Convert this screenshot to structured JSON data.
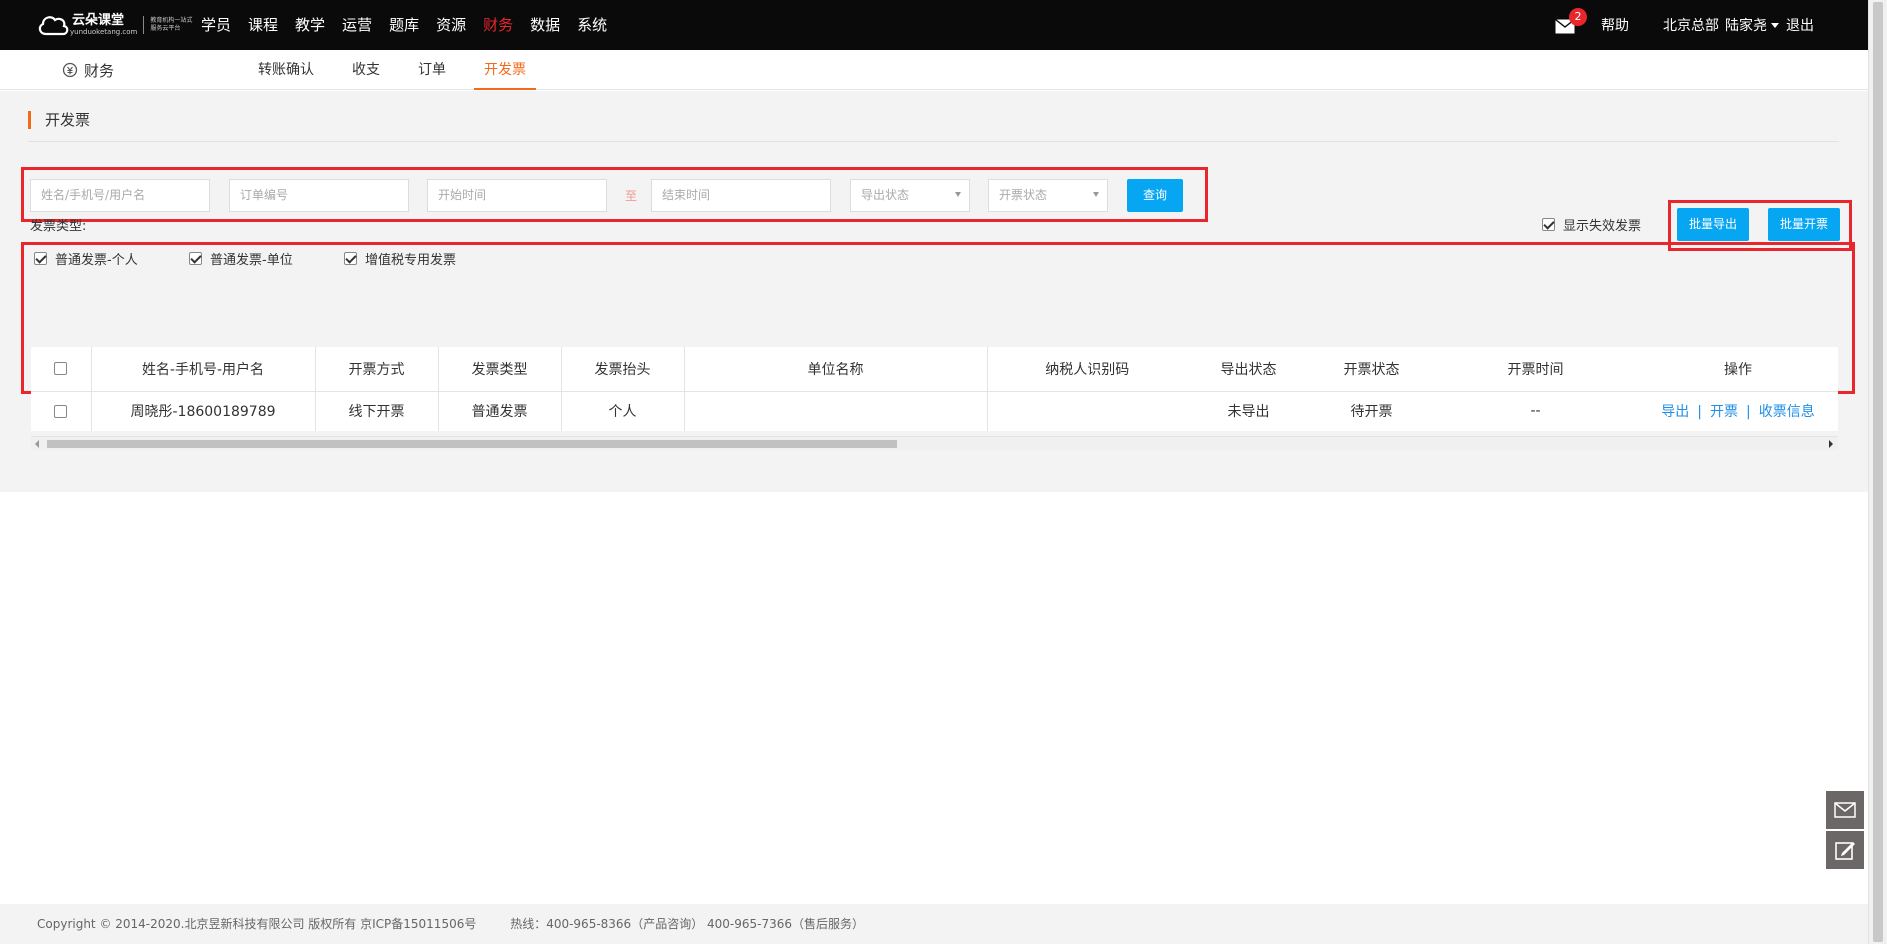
{
  "header": {
    "logo": {
      "name": "云朵课堂",
      "domain": "yunduoketang.com",
      "slogan": "教育机构一站式服务云平台"
    },
    "nav": [
      "学员",
      "课程",
      "教学",
      "运营",
      "题库",
      "资源",
      "财务",
      "数据",
      "系统"
    ],
    "active_nav": "财务",
    "mail_count": "2",
    "help": "帮助",
    "org": "北京总部",
    "user": "陆家尧",
    "logout": "退出"
  },
  "subnav": {
    "module": "财务",
    "tabs": [
      "转账确认",
      "收支",
      "订单",
      "开发票"
    ],
    "active_tab": "开发票"
  },
  "page": {
    "title": "开发票"
  },
  "filters": {
    "name_placeholder": "姓名/手机号/用户名",
    "order_placeholder": "订单编号",
    "start_placeholder": "开始时间",
    "to_label": "至",
    "end_placeholder": "结束时间",
    "export_status": "导出状态",
    "invoice_status": "开票状态",
    "query_button": "查询"
  },
  "invoice_type": {
    "label": "发票类型:",
    "options": [
      {
        "label": "普通发票-个人",
        "checked": true
      },
      {
        "label": "普通发票-单位",
        "checked": true
      },
      {
        "label": "增值税专用发票",
        "checked": true
      }
    ]
  },
  "actions": {
    "show_invalid": "显示失效发票",
    "show_invalid_checked": true,
    "batch_export": "批量导出",
    "batch_invoice": "批量开票"
  },
  "table": {
    "columns": [
      "姓名-手机号-用户名",
      "开票方式",
      "发票类型",
      "发票抬头",
      "单位名称",
      "纳税人识别码",
      "导出状态",
      "开票状态",
      "开票时间",
      "操作"
    ],
    "rows": [
      {
        "name": "周晓彤-18600189789",
        "method": "线下开票",
        "type": "普通发票",
        "title": "个人",
        "company": "",
        "tax_id": "",
        "export_status": "未导出",
        "invoice_status": "待开票",
        "invoice_time": "--",
        "ops": [
          "导出",
          "开票",
          "收票信息"
        ]
      }
    ]
  },
  "footer": {
    "copyright": "Copyright © 2014-2020.北京昱新科技有限公司 版权所有 京ICP备15011506号",
    "hotline": "热线：400-965-8366（产品咨询） 400-965-7366（售后服务）"
  },
  "colors": {
    "accent": "#f26b1d",
    "primary_button": "#06a6f3",
    "nav_active": "#e8262b",
    "highlight_box": "#e8262b"
  }
}
